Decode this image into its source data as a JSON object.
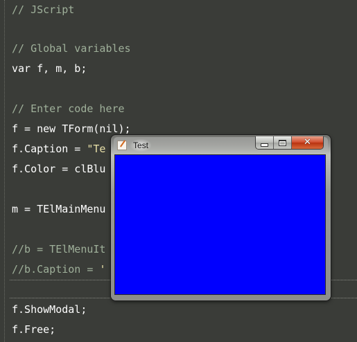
{
  "editor": {
    "lines": [
      {
        "id": "l1",
        "parts": [
          {
            "cls": "comment",
            "text": "// JScript"
          }
        ]
      },
      {
        "id": "l2",
        "parts": []
      },
      {
        "id": "l3",
        "parts": [
          {
            "cls": "comment",
            "text": "// Global variables"
          }
        ]
      },
      {
        "id": "l4",
        "parts": [
          {
            "cls": "code",
            "text": "var f, m, b;"
          }
        ]
      },
      {
        "id": "l5",
        "parts": []
      },
      {
        "id": "l6",
        "parts": [
          {
            "cls": "comment",
            "text": "// Enter code here"
          }
        ]
      },
      {
        "id": "l7",
        "parts": [
          {
            "cls": "code",
            "text": "f = new TForm(nil);"
          }
        ]
      },
      {
        "id": "l8",
        "parts": [
          {
            "cls": "code",
            "text": "f.Caption = "
          },
          {
            "cls": "string",
            "text": "\"Te"
          }
        ]
      },
      {
        "id": "l9",
        "parts": [
          {
            "cls": "code",
            "text": "f.Color = clBlu"
          }
        ]
      },
      {
        "id": "l10",
        "parts": []
      },
      {
        "id": "l11",
        "parts": [
          {
            "cls": "code",
            "text": "m = TElMainMenu"
          }
        ]
      },
      {
        "id": "l12",
        "parts": []
      },
      {
        "id": "l13",
        "parts": [
          {
            "cls": "comment",
            "text": "//b = TElMenuIt"
          }
        ]
      },
      {
        "id": "l14",
        "parts": [
          {
            "cls": "comment",
            "text": "//b.Caption = "
          },
          {
            "cls": "string",
            "text": "'"
          }
        ]
      },
      {
        "id": "l15",
        "parts": []
      },
      {
        "id": "l16",
        "parts": [
          {
            "cls": "code",
            "text": "f.ShowModal;"
          }
        ]
      },
      {
        "id": "l17",
        "parts": [
          {
            "cls": "code",
            "text": "f.Free;"
          }
        ]
      }
    ]
  },
  "window": {
    "title": "Test",
    "icon": "app-form-icon",
    "client_color": "#0000ff",
    "controls": {
      "minimize_icon": "minimize-icon",
      "maximize_icon": "maximize-icon",
      "close_icon": "close-icon",
      "close_glyph": "✕"
    }
  },
  "colors": {
    "editor_background": "#3a3c38",
    "comment": "#9fb09a",
    "code": "#ffffff",
    "string": "#e8e0a8",
    "close_button": "#c8401c"
  }
}
